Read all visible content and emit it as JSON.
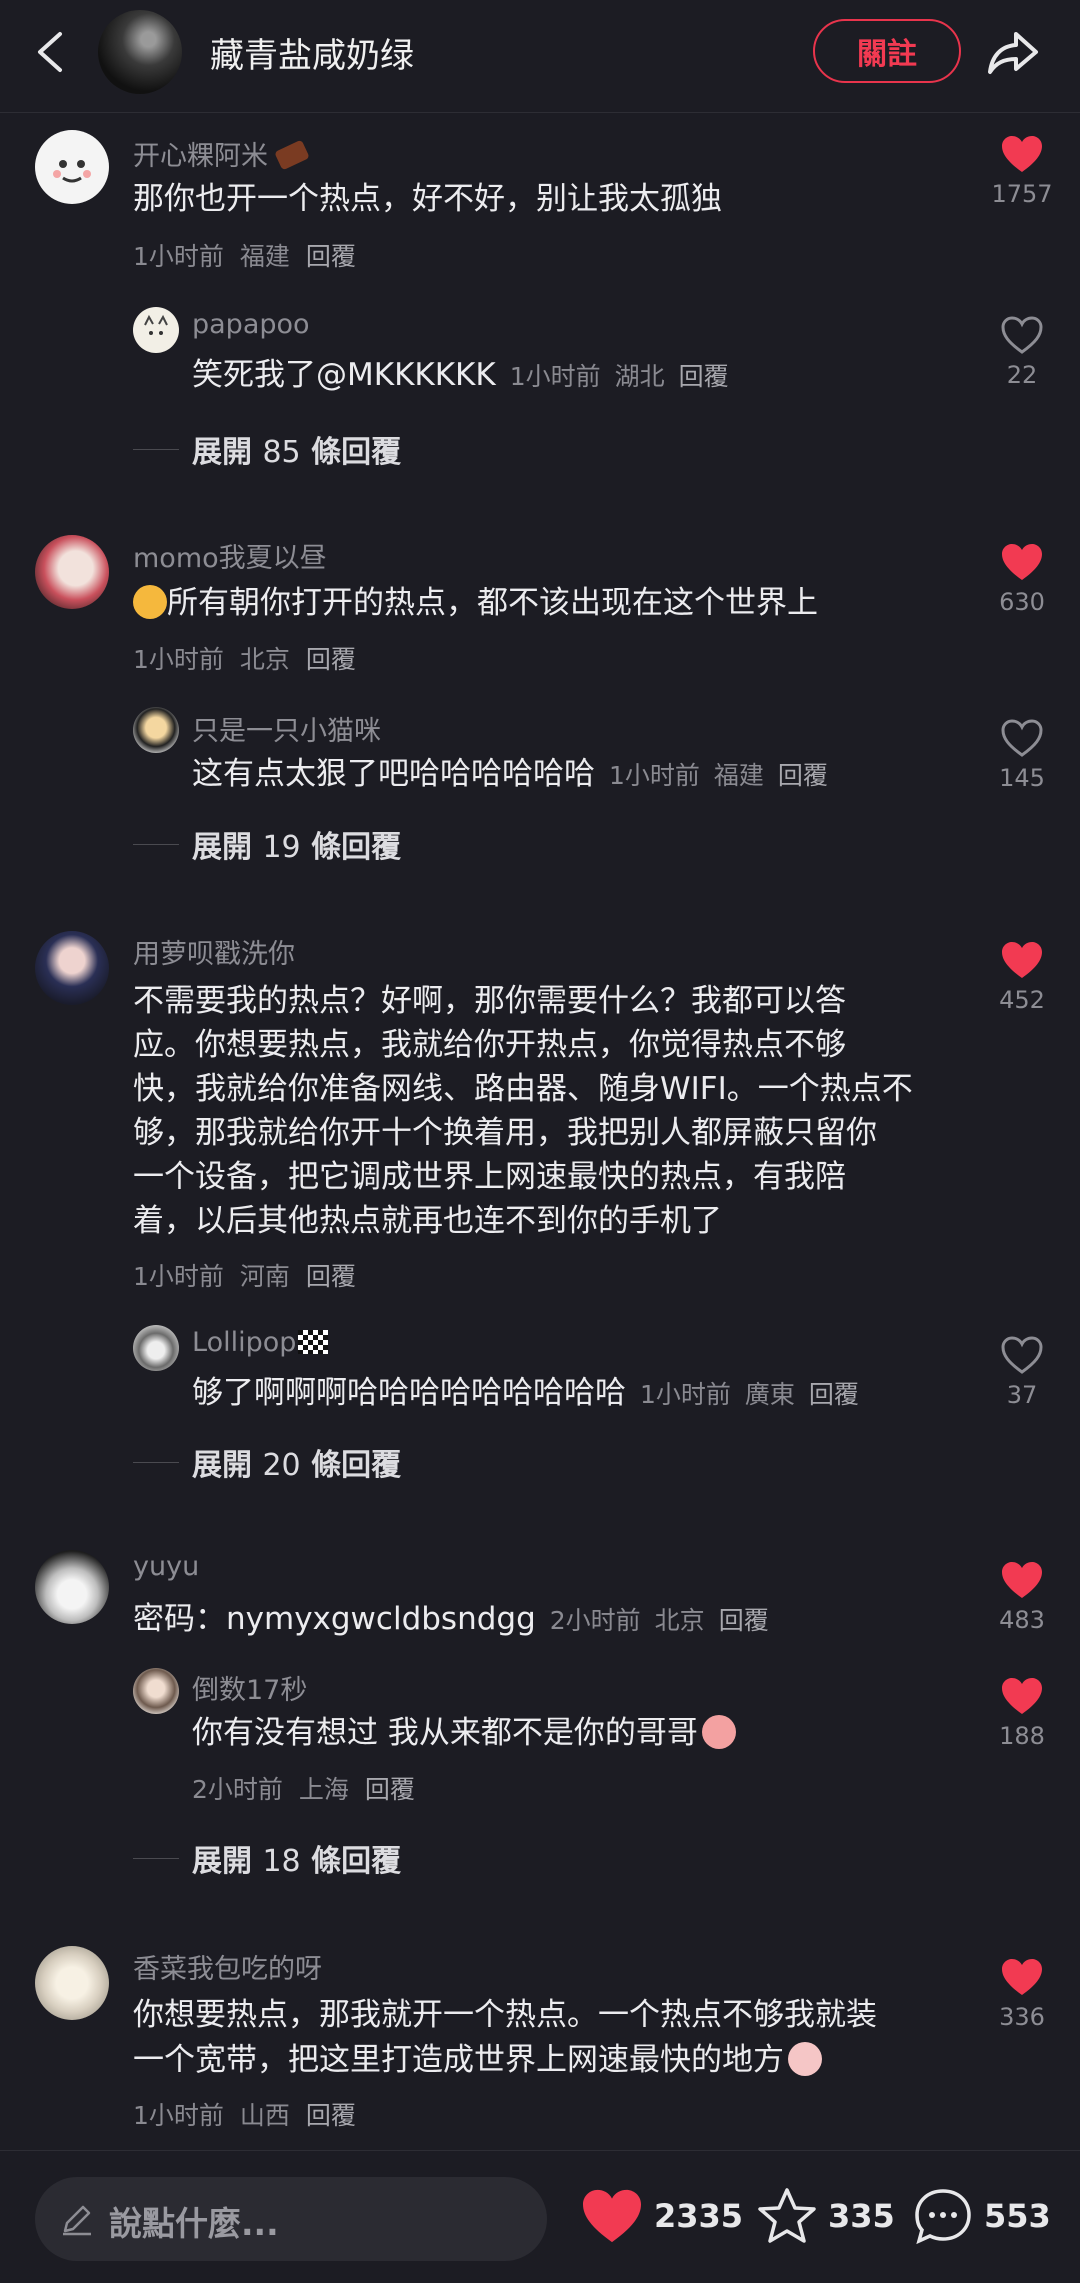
{
  "header": {
    "title": "藏青盐咸奶绿",
    "follow_label": "關註"
  },
  "comments": [
    {
      "username": "开心粿阿米",
      "text": "那你也开一个热点，好不好，别让我太孤独",
      "time": "1小时前",
      "location": "福建",
      "reply_label": "回覆",
      "likes": "1757",
      "liked": true,
      "reply": {
        "username": "papapoo",
        "text": "笑死我了@MKKKKKK",
        "time": "1小时前",
        "location": "湖北",
        "reply_label": "回覆",
        "likes": "22",
        "liked": false
      },
      "expand": {
        "prefix": "展開",
        "count": "85",
        "suffix": "條回覆"
      }
    },
    {
      "username": "momo我夏以昼",
      "text": "所有朝你打开的热点，都不该出现在这个世界上",
      "time": "1小时前",
      "location": "北京",
      "reply_label": "回覆",
      "likes": "630",
      "liked": true,
      "reply": {
        "username": "只是一只小猫咪",
        "text": "这有点太狠了吧哈哈哈哈哈哈",
        "time": "1小时前",
        "location": "福建",
        "reply_label": "回覆",
        "likes": "145",
        "liked": false
      },
      "expand": {
        "prefix": "展開",
        "count": "19",
        "suffix": "條回覆"
      }
    },
    {
      "username": "用萝呗戳洗你",
      "lines": [
        "不需要我的热点？好啊，那你需要什么？我都可以答",
        "应。你想要热点，我就给你开热点，你觉得热点不够",
        "快，我就给你准备网线、路由器、随身WIFI。一个热点不",
        "够，那我就给你开十个换着用，我把别人都屏蔽只留你",
        "一个设备，把它调成世界上网速最快的热点，有我陪",
        "着，以后其他热点就再也连不到你的手机了"
      ],
      "time": "1小时前",
      "location": "河南",
      "reply_label": "回覆",
      "likes": "452",
      "liked": true,
      "reply": {
        "username": "Lollipop",
        "text": "够了啊啊啊哈哈哈哈哈哈哈哈哈",
        "time": "1小时前",
        "location": "廣東",
        "reply_label": "回覆",
        "likes": "37",
        "liked": false
      },
      "expand": {
        "prefix": "展開",
        "count": "20",
        "suffix": "條回覆"
      }
    },
    {
      "username": "yuyu",
      "text": "密码：nymyxgwcldbsndgg",
      "time": "2小时前",
      "location": "北京",
      "reply_label": "回覆",
      "likes": "483",
      "liked": true,
      "reply": {
        "username": "倒数17秒",
        "text": "你有没有想过 我从来都不是你的哥哥",
        "time": "2小时前",
        "location": "上海",
        "reply_label": "回覆",
        "likes": "188",
        "liked": true
      },
      "expand": {
        "prefix": "展開",
        "count": "18",
        "suffix": "條回覆"
      }
    },
    {
      "username": "香菜我包吃的呀",
      "lines": [
        "你想要热点，那我就开一个热点。一个热点不够我就装",
        "一个宽带，把这里打造成世界上网速最快的地方"
      ],
      "time": "1小时前",
      "location": "山西",
      "reply_label": "回覆",
      "likes": "336",
      "liked": true
    }
  ],
  "footer": {
    "input_placeholder": "說點什麼...",
    "likes": "2335",
    "favorites": "335",
    "comments": "553"
  },
  "colors": {
    "accent": "#f23a52",
    "background": "#1c1c23"
  }
}
